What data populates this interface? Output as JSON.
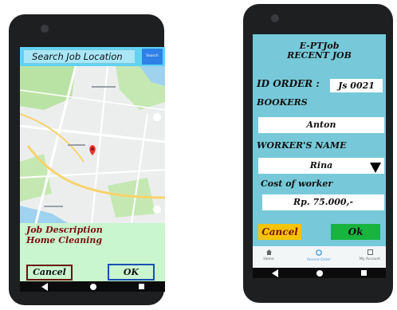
{
  "left_screen": {
    "search": {
      "placeholder": "Search Job Location",
      "button_label": "Search"
    },
    "job_description": {
      "title": "Job Description",
      "value": "Home Cleaning"
    },
    "buttons": {
      "cancel": "Cancel",
      "ok": "OK"
    },
    "map": {
      "pin_icon": "map-pin-icon",
      "colors": {
        "water": "#9fd2ef",
        "park": "#b9e3a4",
        "road": "#ffffff",
        "highway": "#f7d36d",
        "pin": "#e23b32"
      }
    }
  },
  "right_screen": {
    "title": "E-PTJob",
    "subtitle": "RECENT JOB",
    "id_order": {
      "label": "ID ORDER :",
      "value": "Js 0021"
    },
    "bookers": {
      "label": "BOOKERS",
      "value": "Anton"
    },
    "worker_name": {
      "label": "WORKER'S NAME",
      "value": "Rina"
    },
    "cost": {
      "label": "Cost of worker",
      "value": "Rp. 75.000,-"
    },
    "buttons": {
      "cancel": "Cancel",
      "ok": "Ok"
    },
    "bottom_nav": [
      {
        "label": "Home",
        "icon": "home-icon"
      },
      {
        "label": "Recent Order",
        "icon": "recent-order-icon"
      },
      {
        "label": "My Account",
        "icon": "account-icon"
      }
    ],
    "colors": {
      "background": "#77c9d9",
      "cancel_button": "#f5c400",
      "ok_button": "#18b43e",
      "active_nav": "#4a9be0"
    }
  }
}
